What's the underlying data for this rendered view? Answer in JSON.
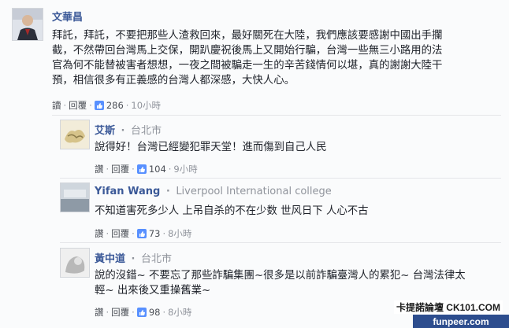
{
  "comments": [
    {
      "name": "文華昌",
      "location": "",
      "lines": [
        "拜託，拜託，不要把那些人渣救回來，最好關死在大陸，我們應該要感謝中國出手攔",
        "截，不然帶回台灣馬上交保，開趴慶祝後馬上又開始行騙，台灣一些無三小路用的法",
        "官為何不能替被害者想想，一夜之間被騙走一生的辛苦錢情何以堪，真的謝謝大陸干",
        "預，相信很多有正義感的台灣人都深感，大快人心。"
      ],
      "reply_label": "讀",
      "reply_btn": "回覆",
      "likes": "286",
      "time": "10小時"
    },
    {
      "name": "艾斯",
      "location": "台北市",
      "lines": [
        "說得好！台灣已經變犯罪天堂！進而傷到自己人民"
      ],
      "reply_label": "讚",
      "reply_btn": "回覆",
      "likes": "104",
      "time": "9小時"
    },
    {
      "name": "Yifan Wang",
      "location": "Liverpool International college",
      "lines": [
        "不知道害死多少人 上吊自杀的不在少数 世风日下 人心不古"
      ],
      "reply_label": "讚",
      "reply_btn": "回覆",
      "likes": "73",
      "time": "8小時"
    },
    {
      "name": "黃中道",
      "location": "台北市",
      "lines": [
        "說的沒錯~ 不要忘了那些詐騙集團~很多是以前詐騙臺灣人的累犯~ 台灣法律太",
        "輕~ 出來後又重操舊業~"
      ],
      "reply_label": "讚",
      "reply_btn": "回覆",
      "likes": "98",
      "time": "8小時"
    }
  ],
  "separator": "·",
  "watermark": "卡提諾論壇 CK101.COM",
  "site": "funpeer.com",
  "colors": {
    "name": "#3b5998",
    "meta": "#90949c",
    "like": "#5890ff"
  },
  "icons": {
    "like": "thumbs-up-icon"
  }
}
